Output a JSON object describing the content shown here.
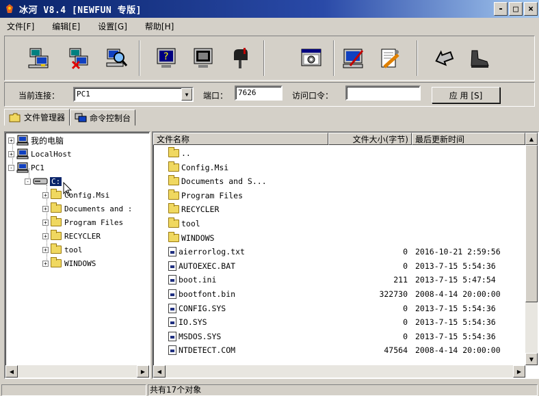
{
  "window": {
    "title": "冰河 V8.4 [NEWFUN 专版]",
    "min": "-",
    "max": "□",
    "close": "×"
  },
  "menu": [
    "文件[F]",
    "编辑[E]",
    "设置[G]",
    "帮助[H]"
  ],
  "toolbar": [
    "add-computer-icon",
    "delete-computer-icon",
    "find-computer-icon",
    "help-monitor-icon",
    "screen-monitor-icon",
    "mailbox-icon",
    "control-panel-icon",
    "config-edit-icon",
    "settings-tools-icon",
    "back-arrow-icon",
    "shoe-icon"
  ],
  "connection": {
    "current_label": "当前连接：",
    "current_value": "PC1",
    "port_label": "端口：",
    "port_value": "7626",
    "password_label": "访问口令：",
    "password_value": "",
    "apply_label": "应 用 [S]"
  },
  "tabs": [
    "文件管理器",
    "命令控制台"
  ],
  "tree": {
    "root": [
      {
        "label": "我的电脑",
        "expander": "+"
      },
      {
        "label": "LocalHost",
        "expander": "+"
      },
      {
        "label": "PC1",
        "expander": "-"
      }
    ],
    "drive": {
      "label": "C:",
      "expander": "-"
    },
    "folders": [
      "Config.Msi",
      "Documents and :",
      "Program Files",
      "RECYCLER",
      "tool",
      "WINDOWS"
    ]
  },
  "filelist": {
    "headers": {
      "name": "文件名称",
      "size": "文件大小(字节)",
      "date": "最后更新时间"
    },
    "rows": [
      {
        "name": "..",
        "type": "folder",
        "size": "",
        "date": ""
      },
      {
        "name": "Config.Msi",
        "type": "folder",
        "size": "",
        "date": ""
      },
      {
        "name": "Documents and S...",
        "type": "folder",
        "size": "",
        "date": ""
      },
      {
        "name": "Program Files",
        "type": "folder",
        "size": "",
        "date": ""
      },
      {
        "name": "RECYCLER",
        "type": "folder",
        "size": "",
        "date": ""
      },
      {
        "name": "tool",
        "type": "folder",
        "size": "",
        "date": ""
      },
      {
        "name": "WINDOWS",
        "type": "folder",
        "size": "",
        "date": ""
      },
      {
        "name": "aierrorlog.txt",
        "type": "file",
        "size": "0",
        "date": "2016-10-21 2:59:56"
      },
      {
        "name": "AUTOEXEC.BAT",
        "type": "file",
        "size": "0",
        "date": "2013-7-15 5:54:36"
      },
      {
        "name": "boot.ini",
        "type": "file",
        "size": "211",
        "date": "2013-7-15 5:47:54"
      },
      {
        "name": "bootfont.bin",
        "type": "file",
        "size": "322730",
        "date": "2008-4-14 20:00:00"
      },
      {
        "name": "CONFIG.SYS",
        "type": "file",
        "size": "0",
        "date": "2013-7-15 5:54:36"
      },
      {
        "name": "IO.SYS",
        "type": "file",
        "size": "0",
        "date": "2013-7-15 5:54:36"
      },
      {
        "name": "MSDOS.SYS",
        "type": "file",
        "size": "0",
        "date": "2013-7-15 5:54:36"
      },
      {
        "name": "NTDETECT.COM",
        "type": "file",
        "size": "47564",
        "date": "2008-4-14 20:00:00"
      }
    ]
  },
  "status": {
    "left": "",
    "right": "共有17个对象"
  }
}
